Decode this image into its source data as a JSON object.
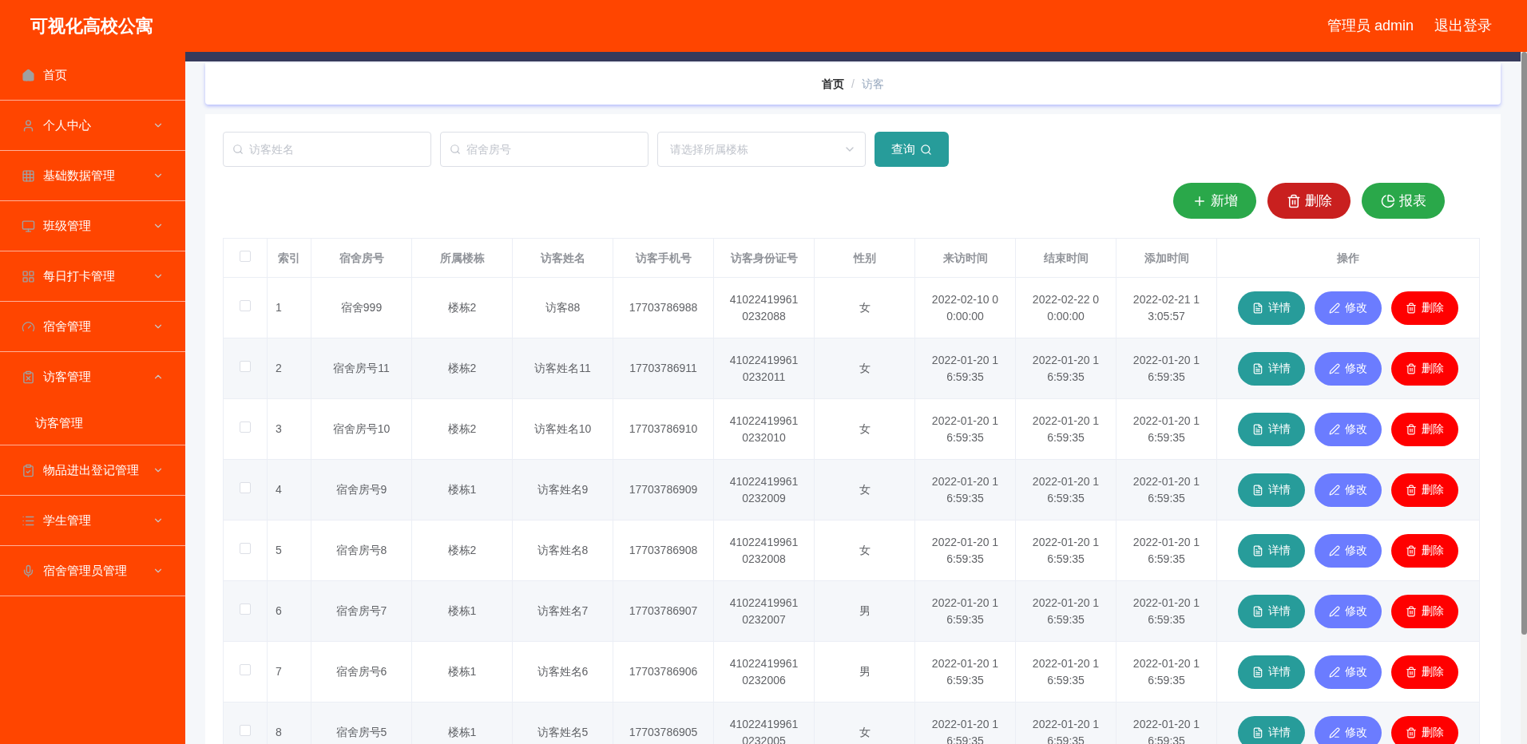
{
  "header": {
    "title": "可视化高校公寓",
    "user": "管理员 admin",
    "logout": "退出登录"
  },
  "sidebar": {
    "items": [
      {
        "label": "首页",
        "kind": "link"
      },
      {
        "label": "个人中心",
        "kind": "menu",
        "expanded": false
      },
      {
        "label": "基础数据管理",
        "kind": "menu",
        "expanded": false
      },
      {
        "label": "班级管理",
        "kind": "menu",
        "expanded": false
      },
      {
        "label": "每日打卡管理",
        "kind": "menu",
        "expanded": false
      },
      {
        "label": "宿舍管理",
        "kind": "menu",
        "expanded": false
      },
      {
        "label": "访客管理",
        "kind": "menu",
        "expanded": true,
        "children": [
          {
            "label": "访客管理"
          }
        ]
      },
      {
        "label": "物品进出登记管理",
        "kind": "menu",
        "expanded": false
      },
      {
        "label": "学生管理",
        "kind": "menu",
        "expanded": false
      },
      {
        "label": "宿舍管理员管理",
        "kind": "menu",
        "expanded": false
      }
    ]
  },
  "breadcrumb": {
    "separator": "/",
    "items": [
      {
        "label": "首页",
        "current": false
      },
      {
        "label": "访客",
        "current": true
      }
    ]
  },
  "search": {
    "fields": [
      {
        "kind": "text",
        "placeholder": "访客姓名"
      },
      {
        "kind": "text",
        "placeholder": "宿舍房号"
      },
      {
        "kind": "select",
        "placeholder": "请选择所属楼栋"
      }
    ],
    "button": "查询"
  },
  "actions": [
    {
      "kind": "add",
      "label": "新增"
    },
    {
      "kind": "delete",
      "label": "删除"
    },
    {
      "kind": "report",
      "label": "报表"
    }
  ],
  "table": {
    "select_all": {
      "checked": false
    },
    "columns": [
      "索引",
      "宿舍房号",
      "所属楼栋",
      "访客姓名",
      "访客手机号",
      "访客身份证号",
      "性别",
      "来访时间",
      "结束时间",
      "添加时间",
      "操作"
    ],
    "rows": [
      {
        "checked": false,
        "cells": [
          "1",
          "宿舍999",
          "楼栋2",
          "访客88",
          "17703786988",
          "410224199610232088",
          "女",
          "2022-02-10 00:00:00",
          "2022-02-22 00:00:00",
          "2022-02-21 13:05:57"
        ],
        "buttons": [
          {
            "kind": "detail",
            "label": "详情"
          },
          {
            "kind": "edit",
            "label": "修改"
          },
          {
            "kind": "delete",
            "label": "删除"
          }
        ]
      },
      {
        "checked": false,
        "cells": [
          "2",
          "宿舍房号11",
          "楼栋2",
          "访客姓名11",
          "17703786911",
          "410224199610232011",
          "女",
          "2022-01-20 16:59:35",
          "2022-01-20 16:59:35",
          "2022-01-20 16:59:35"
        ],
        "buttons": [
          {
            "kind": "detail",
            "label": "详情"
          },
          {
            "kind": "edit",
            "label": "修改"
          },
          {
            "kind": "delete",
            "label": "删除"
          }
        ]
      },
      {
        "checked": false,
        "cells": [
          "3",
          "宿舍房号10",
          "楼栋2",
          "访客姓名10",
          "17703786910",
          "410224199610232010",
          "女",
          "2022-01-20 16:59:35",
          "2022-01-20 16:59:35",
          "2022-01-20 16:59:35"
        ],
        "buttons": [
          {
            "kind": "detail",
            "label": "详情"
          },
          {
            "kind": "edit",
            "label": "修改"
          },
          {
            "kind": "delete",
            "label": "删除"
          }
        ]
      },
      {
        "checked": false,
        "cells": [
          "4",
          "宿舍房号9",
          "楼栋1",
          "访客姓名9",
          "17703786909",
          "410224199610232009",
          "女",
          "2022-01-20 16:59:35",
          "2022-01-20 16:59:35",
          "2022-01-20 16:59:35"
        ],
        "buttons": [
          {
            "kind": "detail",
            "label": "详情"
          },
          {
            "kind": "edit",
            "label": "修改"
          },
          {
            "kind": "delete",
            "label": "删除"
          }
        ]
      },
      {
        "checked": false,
        "cells": [
          "5",
          "宿舍房号8",
          "楼栋2",
          "访客姓名8",
          "17703786908",
          "410224199610232008",
          "女",
          "2022-01-20 16:59:35",
          "2022-01-20 16:59:35",
          "2022-01-20 16:59:35"
        ],
        "buttons": [
          {
            "kind": "detail",
            "label": "详情"
          },
          {
            "kind": "edit",
            "label": "修改"
          },
          {
            "kind": "delete",
            "label": "删除"
          }
        ]
      },
      {
        "checked": false,
        "cells": [
          "6",
          "宿舍房号7",
          "楼栋1",
          "访客姓名7",
          "17703786907",
          "410224199610232007",
          "男",
          "2022-01-20 16:59:35",
          "2022-01-20 16:59:35",
          "2022-01-20 16:59:35"
        ],
        "buttons": [
          {
            "kind": "detail",
            "label": "详情"
          },
          {
            "kind": "edit",
            "label": "修改"
          },
          {
            "kind": "delete",
            "label": "删除"
          }
        ]
      },
      {
        "checked": false,
        "cells": [
          "7",
          "宿舍房号6",
          "楼栋1",
          "访客姓名6",
          "17703786906",
          "410224199610232006",
          "男",
          "2022-01-20 16:59:35",
          "2022-01-20 16:59:35",
          "2022-01-20 16:59:35"
        ],
        "buttons": [
          {
            "kind": "detail",
            "label": "详情"
          },
          {
            "kind": "edit",
            "label": "修改"
          },
          {
            "kind": "delete",
            "label": "删除"
          }
        ]
      },
      {
        "checked": false,
        "cells": [
          "8",
          "宿舍房号5",
          "楼栋1",
          "访客姓名5",
          "17703786905",
          "410224199610232005",
          "女",
          "2022-01-20 16:59:35",
          "2022-01-20 16:59:35",
          "2022-01-20 16:59:35"
        ],
        "buttons": [
          {
            "kind": "detail",
            "label": "详情"
          },
          {
            "kind": "edit",
            "label": "修改"
          },
          {
            "kind": "delete",
            "label": "删除"
          }
        ]
      }
    ]
  }
}
